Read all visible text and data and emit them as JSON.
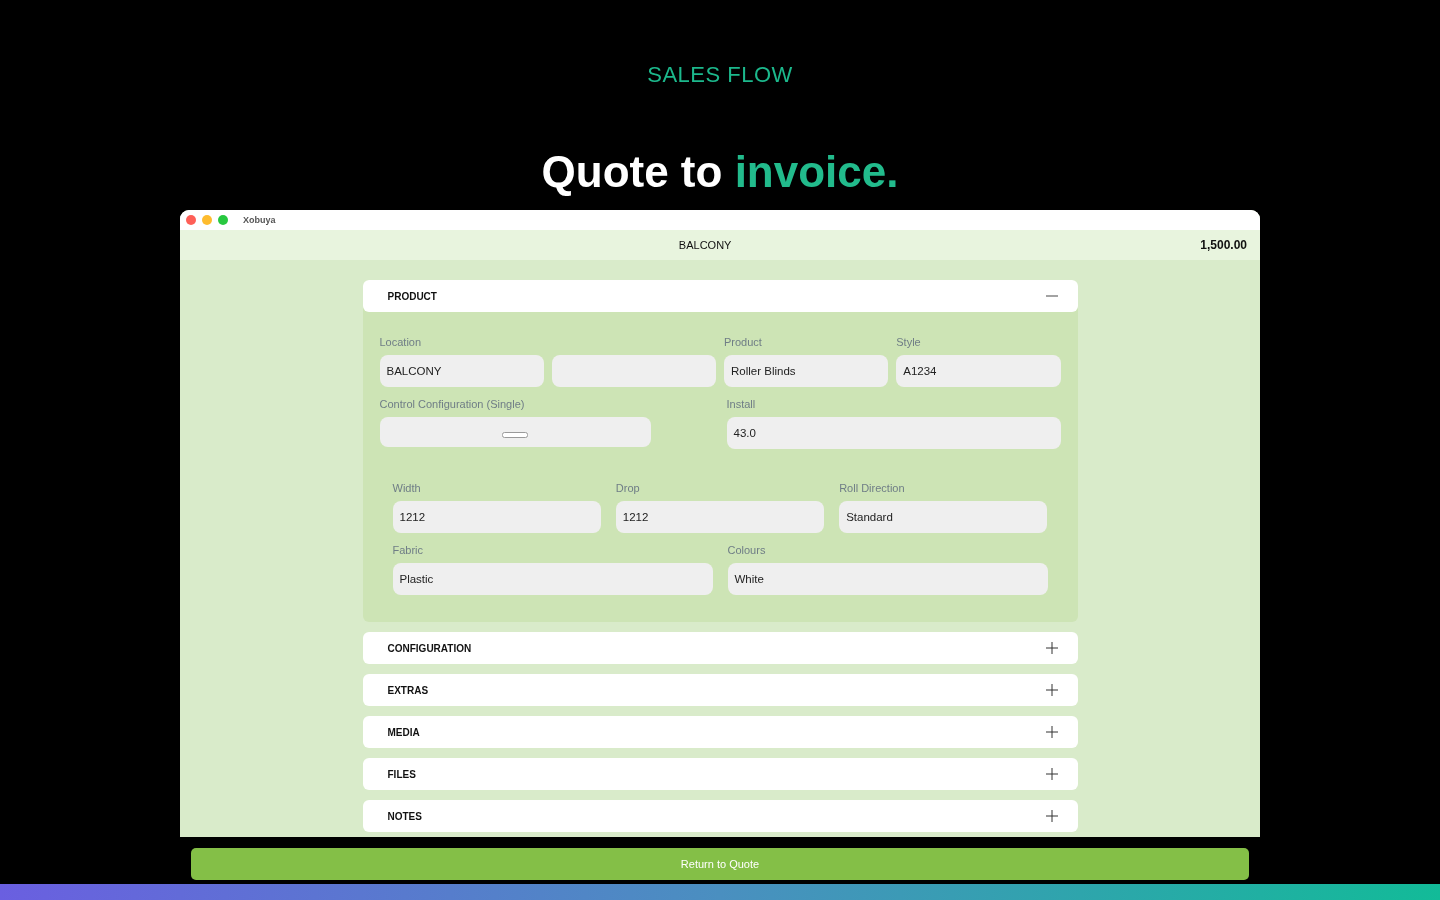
{
  "page": {
    "eyebrow": "SALES FLOW",
    "headline": {
      "text": "Quote to",
      "accent": "invoice."
    }
  },
  "window": {
    "title": "Xobuya",
    "header": {
      "title": "BALCONY",
      "total": "1,500.00"
    }
  },
  "sections": [
    {
      "title": "PRODUCT",
      "expanded": true,
      "groups": [
        {
          "rows": [
            [
              {
                "kind": "text",
                "label": "Location",
                "value": "BALCONY"
              },
              {
                "kind": "text"
              },
              {
                "kind": "text",
                "label": "Product",
                "value": "Roller Blinds"
              },
              {
                "kind": "text",
                "label": "Style",
                "value": "A1234"
              }
            ],
            [
              {
                "kind": "control",
                "label": "Control Configuration (Single)"
              },
              {
                "kind": "text",
                "label": "Install",
                "value": "43.0"
              }
            ]
          ]
        },
        {
          "rows": [
            [
              {
                "kind": "text",
                "label": "Width",
                "value": "1212"
              },
              {
                "kind": "text",
                "label": "Drop",
                "value": "1212"
              },
              {
                "kind": "text",
                "label": "Roll Direction",
                "value": "Standard"
              }
            ],
            [
              {
                "kind": "text",
                "label": "Fabric",
                "value": "Plastic"
              },
              {
                "kind": "text",
                "label": "Colours",
                "value": "White"
              }
            ]
          ]
        }
      ]
    },
    {
      "title": "CONFIGURATION",
      "expanded": false
    },
    {
      "title": "EXTRAS",
      "expanded": false
    },
    {
      "title": "MEDIA",
      "expanded": false
    },
    {
      "title": "FILES",
      "expanded": false
    },
    {
      "title": "NOTES",
      "expanded": false
    }
  ],
  "footer": {
    "button": "Return to Quote"
  }
}
